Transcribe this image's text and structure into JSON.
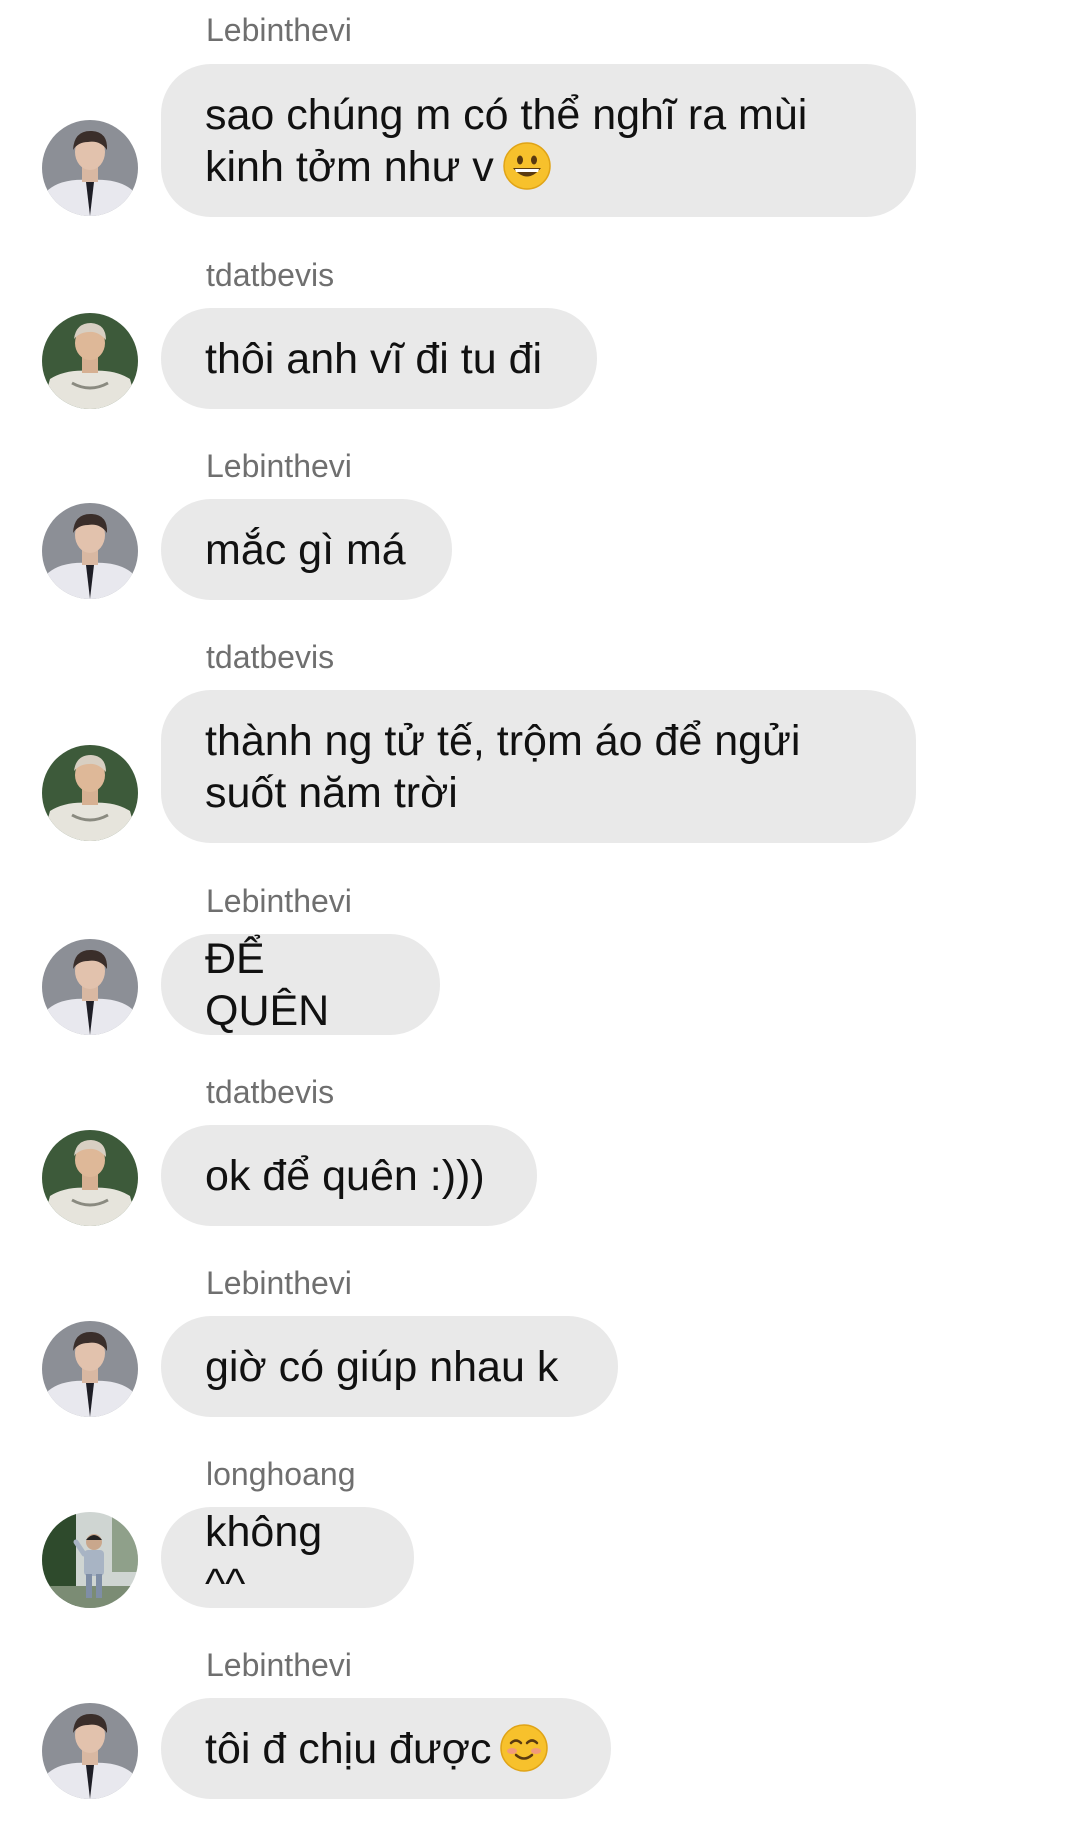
{
  "messages": [
    {
      "sender": "Lebinthevi",
      "text": "sao chúng m có thể nghĩ ra mùi\nkinh tởm như v",
      "emoji": "grinning-face-emoji",
      "avatar": "lebinthevi-avatar"
    },
    {
      "sender": "tdatbevis",
      "text": "thôi anh vĩ đi tu đi",
      "avatar": "tdatbevis-avatar"
    },
    {
      "sender": "Lebinthevi",
      "text": "mắc gì má",
      "avatar": "lebinthevi-avatar"
    },
    {
      "sender": "tdatbevis",
      "text": "thành ng tử tế, trộm áo để ngửi\nsuốt năm trời",
      "avatar": "tdatbevis-avatar"
    },
    {
      "sender": "Lebinthevi",
      "text": "ĐỂ QUÊN",
      "avatar": "lebinthevi-avatar"
    },
    {
      "sender": "tdatbevis",
      "text": "ok để quên :)))",
      "avatar": "tdatbevis-avatar"
    },
    {
      "sender": "Lebinthevi",
      "text": "giờ có giúp nhau k",
      "avatar": "lebinthevi-avatar"
    },
    {
      "sender": "longhoang",
      "text": "không ^^",
      "avatar": "longhoang-avatar"
    },
    {
      "sender": "Lebinthevi",
      "text": "tôi đ chịu được",
      "emoji": "smiling-face-emoji",
      "avatar": "lebinthevi-avatar"
    }
  ],
  "colors": {
    "bubble": "#e9e9e9",
    "sender_name": "#6f6f6f",
    "message_text": "#111111",
    "emoji_face": "#f7c12c"
  }
}
